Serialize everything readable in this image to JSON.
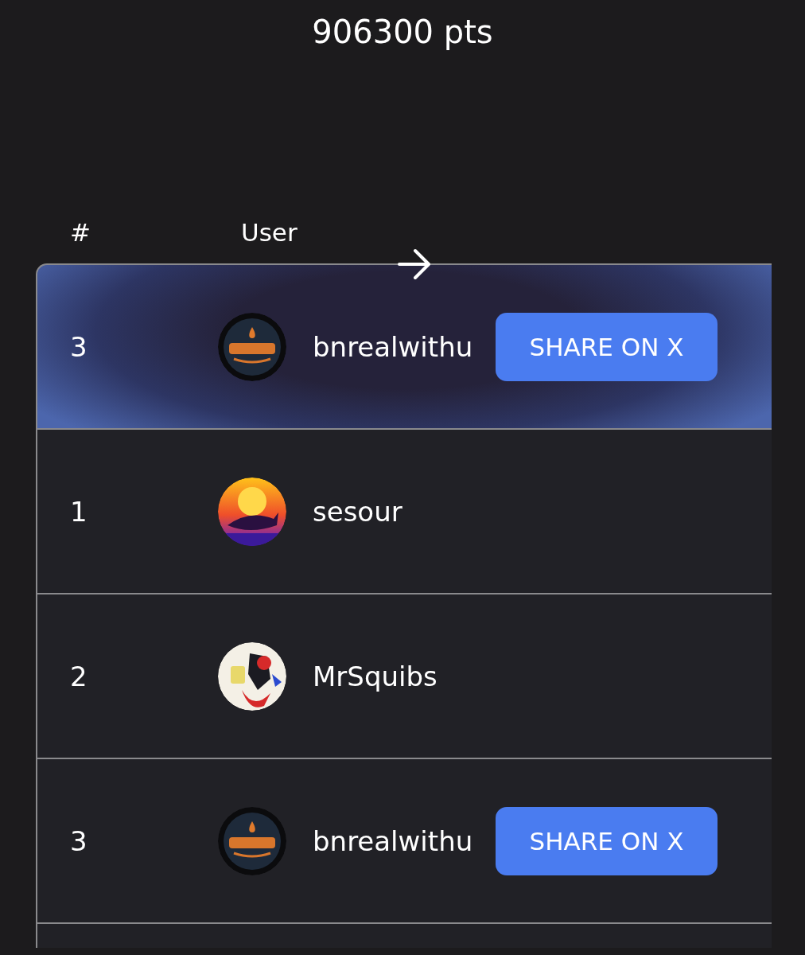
{
  "score": "906300 pts",
  "columns": [
    "#",
    "User"
  ],
  "rows": [
    {
      "rank": "3",
      "user": "bnrealwithu",
      "highlighted": true,
      "share_label": "SHARE ON X"
    },
    {
      "rank": "1",
      "user": "sesour",
      "highlighted": false
    },
    {
      "rank": "2",
      "user": "MrSquibs",
      "highlighted": false
    },
    {
      "rank": "3",
      "user": "bnrealwithu",
      "highlighted": false,
      "share_label": "SHARE ON X"
    }
  ]
}
